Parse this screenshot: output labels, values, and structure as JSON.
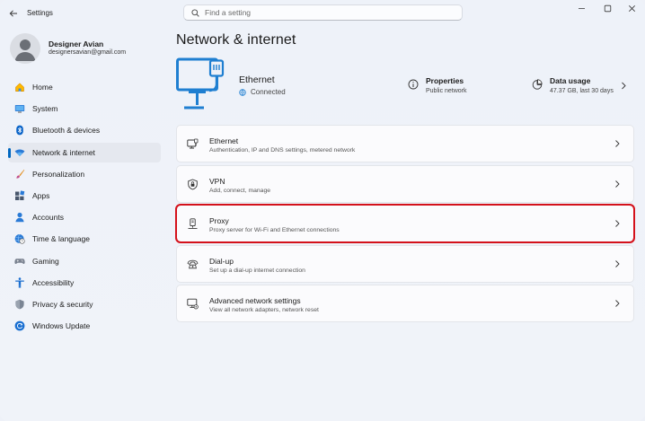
{
  "app": {
    "title": "Settings"
  },
  "search": {
    "placeholder": "Find a setting"
  },
  "user": {
    "name": "Designer Avian",
    "email": "designersavian@gmail.com"
  },
  "sidebar": {
    "items": [
      {
        "label": "Home",
        "icon": "home-icon",
        "active": false
      },
      {
        "label": "System",
        "icon": "system-icon",
        "active": false
      },
      {
        "label": "Bluetooth & devices",
        "icon": "bluetooth-icon",
        "active": false
      },
      {
        "label": "Network & internet",
        "icon": "wifi-icon",
        "active": true
      },
      {
        "label": "Personalization",
        "icon": "brush-icon",
        "active": false
      },
      {
        "label": "Apps",
        "icon": "apps-icon",
        "active": false
      },
      {
        "label": "Accounts",
        "icon": "accounts-icon",
        "active": false
      },
      {
        "label": "Time & language",
        "icon": "globe-clock-icon",
        "active": false
      },
      {
        "label": "Gaming",
        "icon": "gamepad-icon",
        "active": false
      },
      {
        "label": "Accessibility",
        "icon": "accessibility-icon",
        "active": false
      },
      {
        "label": "Privacy & security",
        "icon": "shield-icon",
        "active": false
      },
      {
        "label": "Windows Update",
        "icon": "update-icon",
        "active": false
      }
    ]
  },
  "main": {
    "title": "Network & internet",
    "connection": {
      "name": "Ethernet",
      "status": "Connected",
      "properties_title": "Properties",
      "properties_sub": "Public network",
      "usage_title": "Data usage",
      "usage_sub": "47.37 GB, last 30 days"
    },
    "cards": [
      {
        "title": "Ethernet",
        "desc": "Authentication, IP and DNS settings, metered network",
        "icon": "ethernet-icon",
        "selected": false
      },
      {
        "title": "VPN",
        "desc": "Add, connect, manage",
        "icon": "vpn-shield-icon",
        "selected": false
      },
      {
        "title": "Proxy",
        "desc": "Proxy server for Wi-Fi and Ethernet connections",
        "icon": "proxy-icon",
        "selected": true
      },
      {
        "title": "Dial-up",
        "desc": "Set up a dial-up internet connection",
        "icon": "dialup-icon",
        "selected": false
      },
      {
        "title": "Advanced network settings",
        "desc": "View all network adapters, network reset",
        "icon": "advanced-network-icon",
        "selected": false
      }
    ]
  },
  "colors": {
    "accent": "#0067c0",
    "highlight": "#d4111b",
    "background": "#eef1f8"
  }
}
